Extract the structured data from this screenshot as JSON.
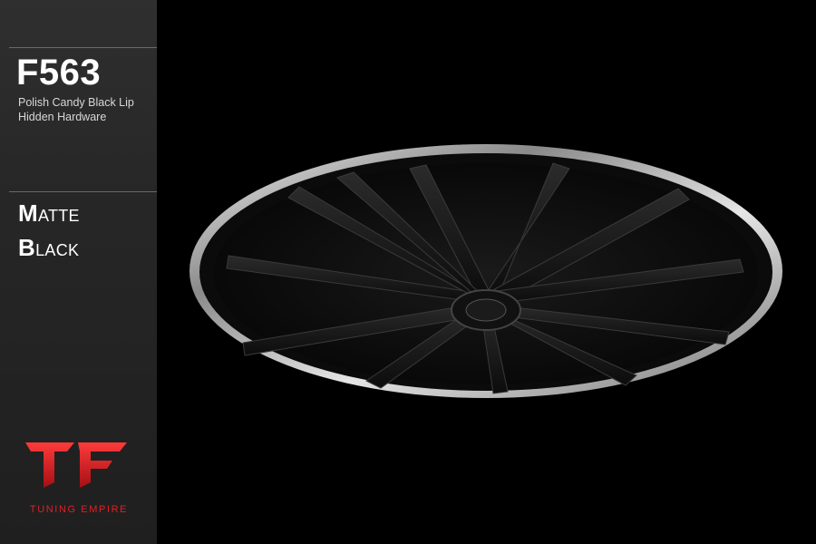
{
  "product": {
    "model": "F563",
    "spec_line_1": "Polish Candy Black  Lip",
    "spec_line_2": "Hidden Hardware",
    "finish_word_1_initial": "M",
    "finish_word_1_rest": "atte",
    "finish_word_2_initial": "B",
    "finish_word_2_rest": "lack"
  },
  "brand": {
    "name": "TUNING EMPIRE",
    "logo": "tf-logo",
    "logo_color": "#e21f26"
  },
  "colors": {
    "background": "#000000",
    "sidebar": "#2a2a2a",
    "lip": "#bfbfbf",
    "wheel_face": "#0e0e0e"
  }
}
